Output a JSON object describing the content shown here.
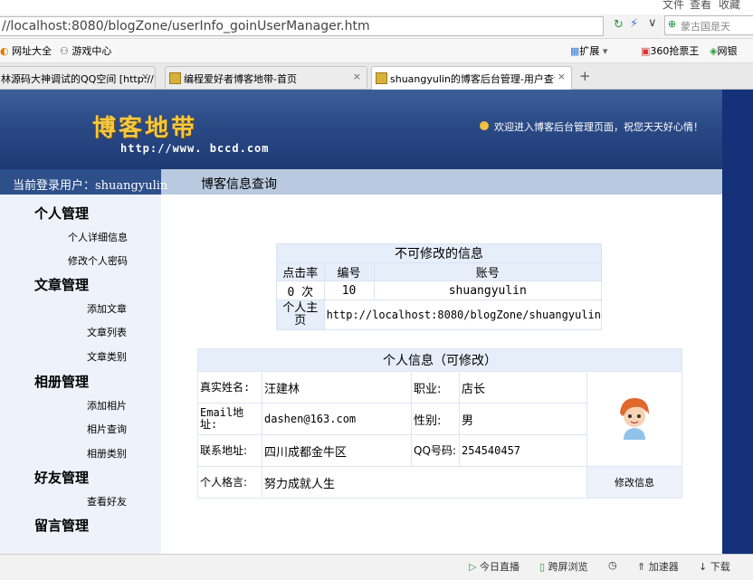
{
  "browser": {
    "menu": [
      "文件",
      "查看",
      "收藏"
    ],
    "url": "//localhost:8080/blogZone/userInfo_goinUserManager.htm",
    "search_placeholder": "蒙古国是天",
    "bookmarks": [
      "网址大全",
      "游戏中心"
    ],
    "bookmarks_right": [
      "扩展",
      "360抢票王",
      "网银"
    ],
    "tabs": [
      {
        "label": "林源码大神调试的QQ空间 [http://",
        "active": false
      },
      {
        "label": "编程爱好者博客地带-首页",
        "active": false
      },
      {
        "label": "shuangyulin的博客后台管理-用户查询",
        "active": true
      }
    ],
    "new_tab": "+"
  },
  "header": {
    "logo": "博客地带",
    "logo_url": "http://www.  bccd.com",
    "welcome": "欢迎进入博客后台管理页面，祝您天天好心情！"
  },
  "userbar": {
    "current_user": "当前登录用户：shuangyulin",
    "section_title": "博客信息查询"
  },
  "sidebar": {
    "groups": [
      {
        "title": "个人管理",
        "items": [
          "个人详细信息",
          "修改个人密码"
        ]
      },
      {
        "title": "文章管理",
        "items": [
          "添加文章",
          "文章列表",
          "文章类别"
        ]
      },
      {
        "title": "相册管理",
        "items": [
          "添加相片",
          "相片查询",
          "相册类别"
        ]
      },
      {
        "title": "好友管理",
        "items": [
          "查看好友"
        ]
      },
      {
        "title": "留言管理",
        "items": []
      }
    ]
  },
  "readonly_info": {
    "title": "不可修改的信息",
    "headers": [
      "点击率",
      "编号",
      "账号"
    ],
    "values": [
      "0 次",
      "10",
      "shuangyulin"
    ],
    "homepage_label": "个人主页",
    "homepage": "http://localhost:8080/blogZone/shuangyulin"
  },
  "personal_info": {
    "title": "个人信息（可修改）",
    "real_name_label": "真实姓名:",
    "real_name": "汪建林",
    "job_label": "职业:",
    "job": "店长",
    "email_label": "Email地址:",
    "email": "dashen@163.com",
    "gender_label": "性别:",
    "gender": "男",
    "address_label": "联系地址:",
    "address": "四川成都金牛区",
    "qq_label": "QQ号码:",
    "qq": "254540457",
    "motto_label": "个人格言:",
    "motto": "努力成就人生",
    "edit_label": "修改信息"
  },
  "statusbar": {
    "items": [
      "今日直播",
      "跨屏浏览",
      "加速器",
      "下载"
    ]
  }
}
